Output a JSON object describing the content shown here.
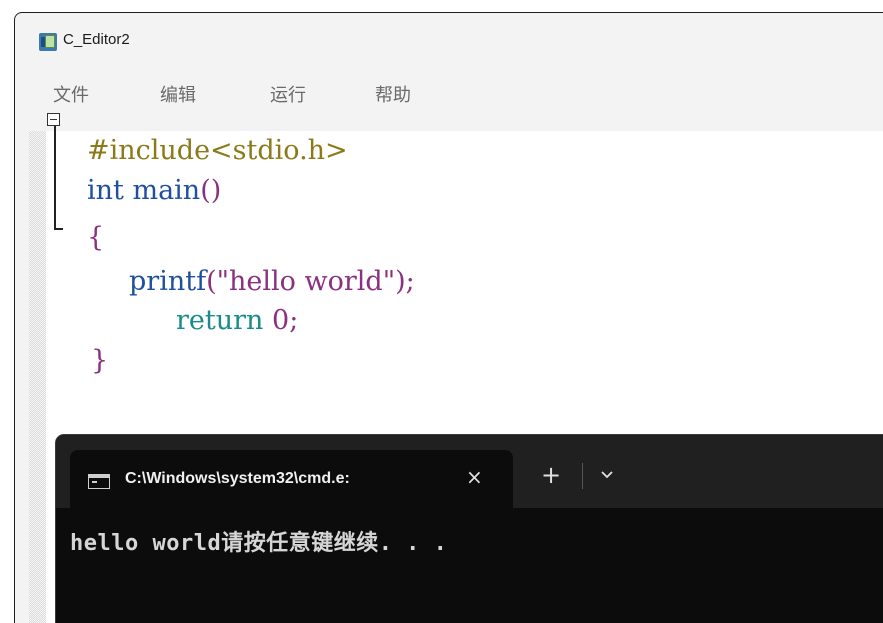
{
  "window": {
    "title": "C_Editor2",
    "icon": "c-editor-icon"
  },
  "menu": {
    "items": [
      {
        "label": "文件"
      },
      {
        "label": "编辑"
      },
      {
        "label": "运行"
      },
      {
        "label": "帮助"
      }
    ]
  },
  "code": {
    "line1": "#include<stdio.h>",
    "line2_kw": "int",
    "line2_rest_id": "main",
    "line2_paren": "()",
    "line3": "{",
    "line4_func": "printf",
    "line4_open": "(",
    "line4_str": "\"hello world\"",
    "line4_close": ");",
    "line5_kw": "return",
    "line5_num": "0",
    "line5_semi": ";",
    "line6": "}"
  },
  "terminal": {
    "tab_title": "C:\\Windows\\system32\\cmd.e:",
    "close_icon": "×",
    "new_tab_icon": "+",
    "output": "hello world请按任意键继续. . ."
  },
  "colors": {
    "terminal_bg": "#0c0c0c",
    "editor_bg": "#ffffff",
    "keyword": "#1e4fa0",
    "string": "#8b2f7f",
    "preprocessor": "#8b7a1a"
  }
}
